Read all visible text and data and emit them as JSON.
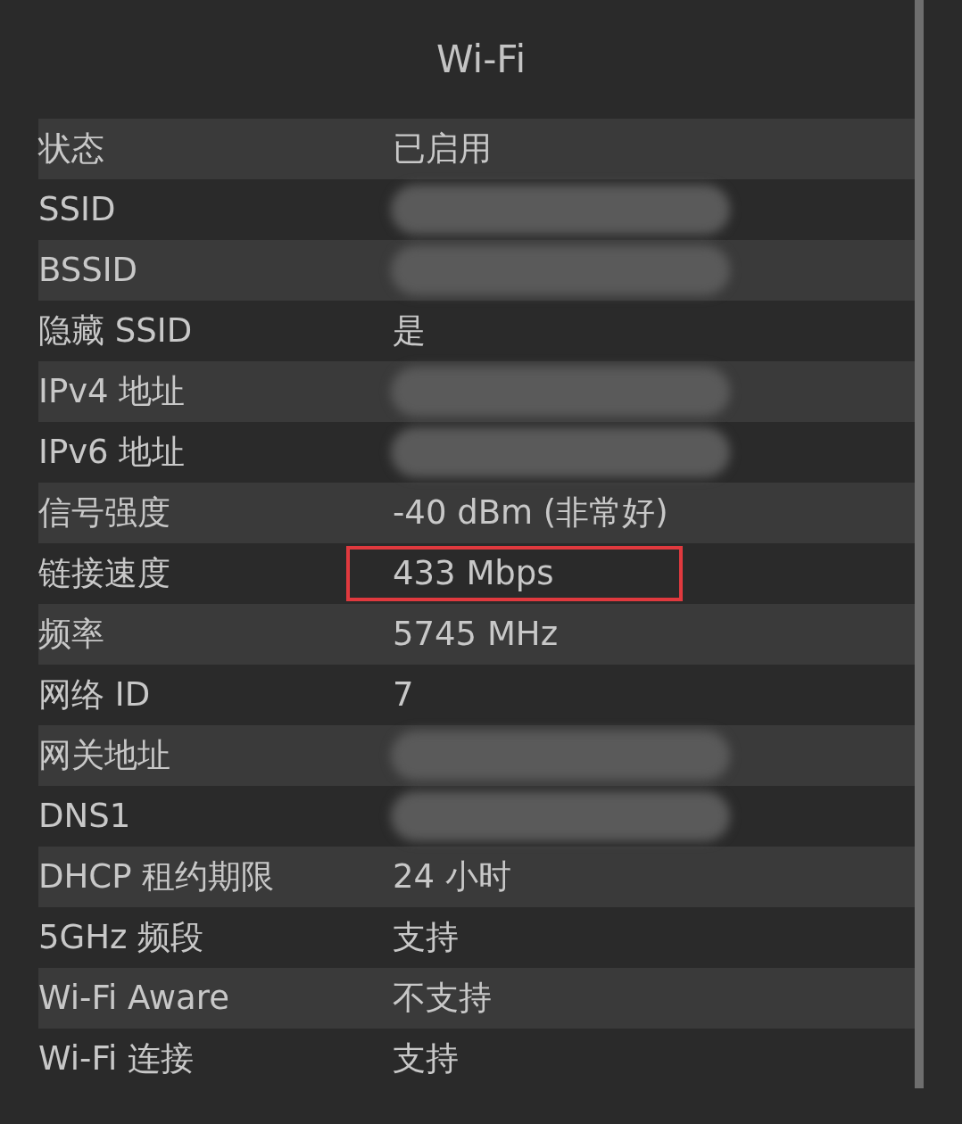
{
  "title": "Wi-Fi",
  "rows": [
    {
      "label": "状态",
      "value": "已启用",
      "redacted": false,
      "highlighted": false
    },
    {
      "label": "SSID",
      "redacted": true,
      "highlighted": false
    },
    {
      "label": "BSSID",
      "redacted": true,
      "highlighted": false
    },
    {
      "label": "隐藏 SSID",
      "value": "是",
      "redacted": false,
      "highlighted": false
    },
    {
      "label": "IPv4 地址",
      "redacted": true,
      "highlighted": false
    },
    {
      "label": "IPv6 地址",
      "redacted": true,
      "highlighted": false
    },
    {
      "label": "信号强度",
      "value": "-40 dBm (非常好)",
      "redacted": false,
      "highlighted": false
    },
    {
      "label": "链接速度",
      "value": "433 Mbps",
      "redacted": false,
      "highlighted": true
    },
    {
      "label": "频率",
      "value": "5745 MHz",
      "redacted": false,
      "highlighted": false
    },
    {
      "label": "网络 ID",
      "value": "7",
      "redacted": false,
      "highlighted": false
    },
    {
      "label": "网关地址",
      "redacted": true,
      "highlighted": false
    },
    {
      "label": "DNS1",
      "redacted": true,
      "highlighted": false
    },
    {
      "label": "DHCP 租约期限",
      "value": "24 小时",
      "redacted": false,
      "highlighted": false
    },
    {
      "label": "5GHz 频段",
      "value": "支持",
      "redacted": false,
      "highlighted": false
    },
    {
      "label": "Wi-Fi Aware",
      "value": "不支持",
      "redacted": false,
      "highlighted": false
    },
    {
      "label": "Wi-Fi 连接",
      "value": "支持",
      "redacted": false,
      "highlighted": false
    }
  ]
}
